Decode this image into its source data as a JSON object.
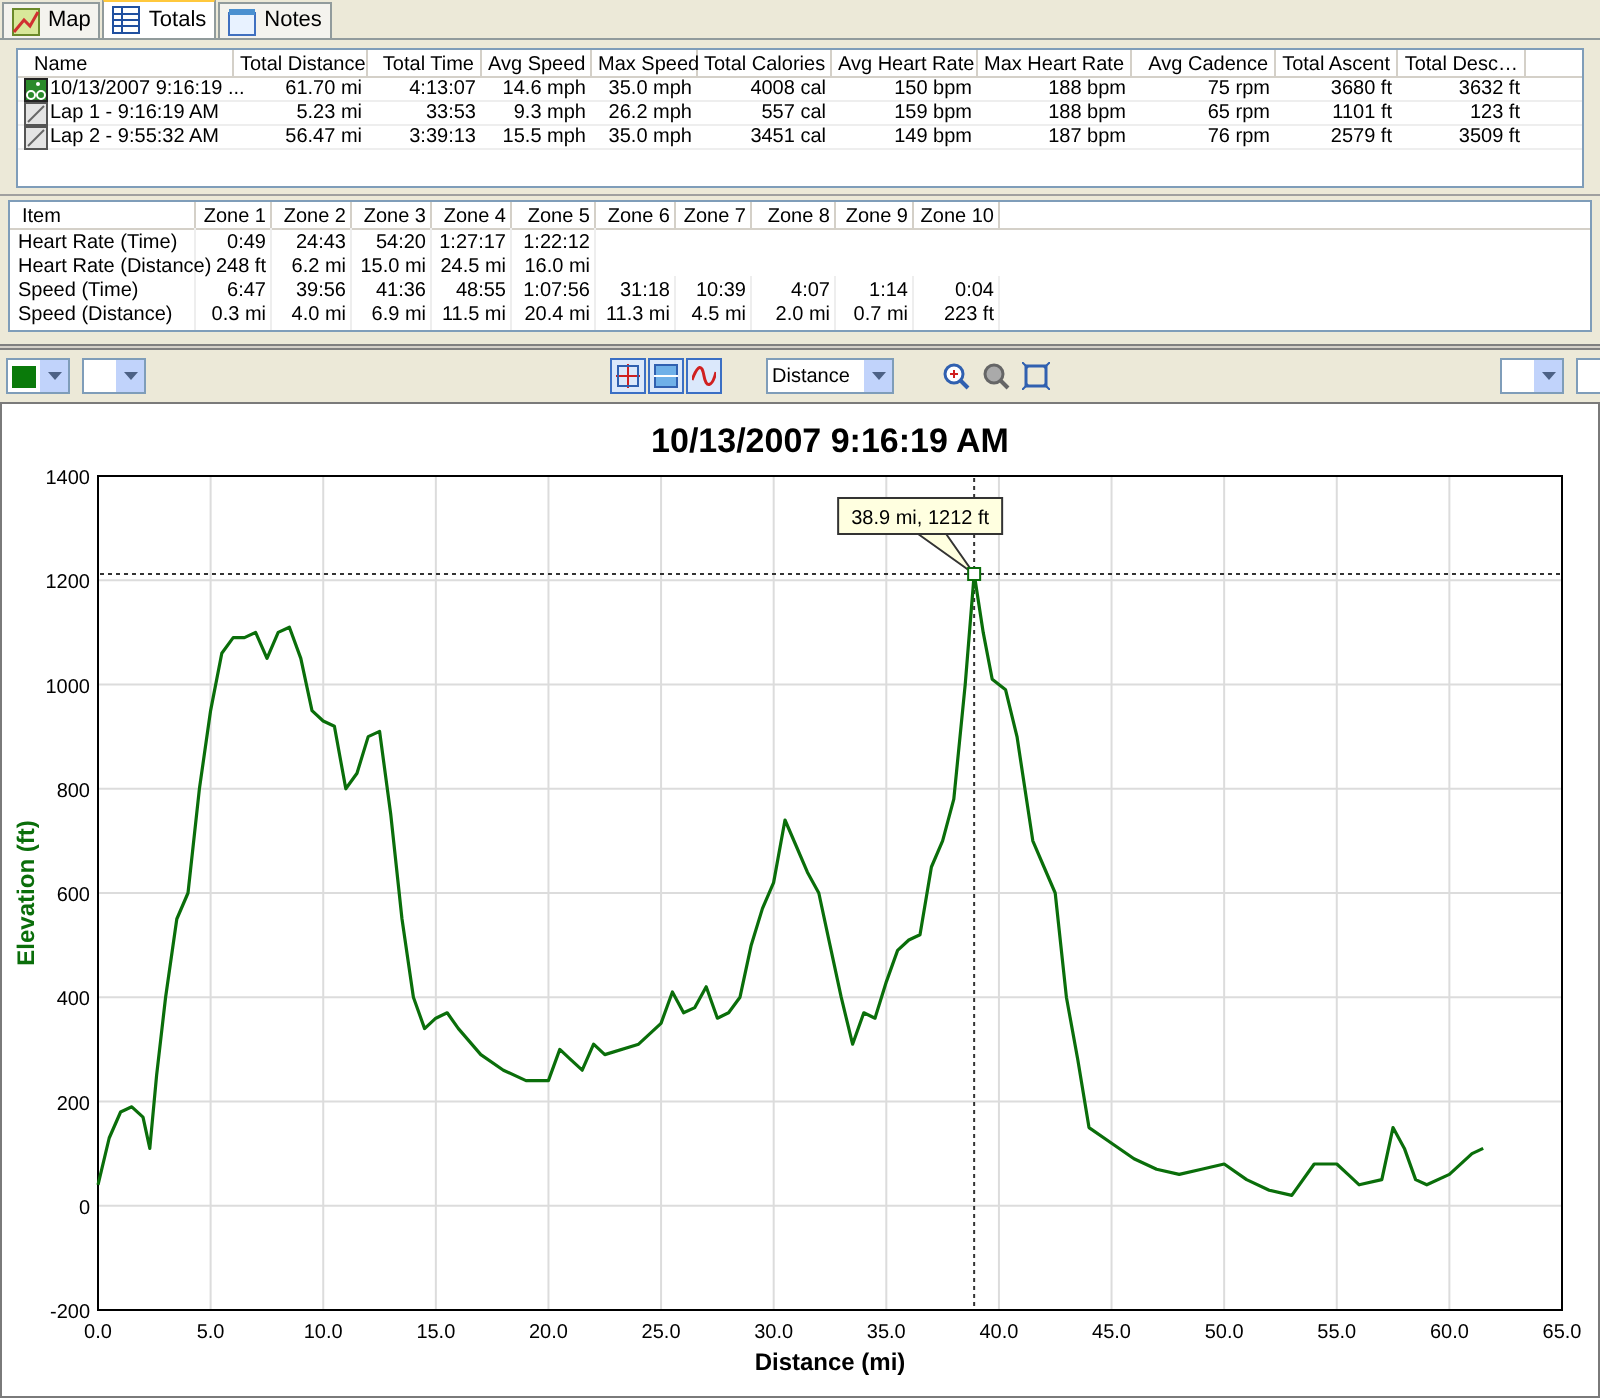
{
  "tabs": [
    {
      "label": "Map",
      "selected": false
    },
    {
      "label": "Totals",
      "selected": true
    },
    {
      "label": "Notes",
      "selected": false
    }
  ],
  "totals": {
    "columns": [
      "Name",
      "Total Distance",
      "Total Time",
      "Avg Speed",
      "Max Speed",
      "Total Calories",
      "Avg Heart Rate",
      "Max Heart Rate",
      "Avg Cadence",
      "Total Ascent",
      "Total Desc…"
    ],
    "rows": [
      {
        "kind": "activity",
        "cells": [
          "10/13/2007 9:16:19 ...",
          "61.70 mi",
          "4:13:07",
          "14.6 mph",
          "35.0 mph",
          "4008 cal",
          "150 bpm",
          "188 bpm",
          "75 rpm",
          "3680 ft",
          "3632 ft"
        ]
      },
      {
        "kind": "lap",
        "cells": [
          "Lap 1 - 9:16:19 AM",
          "5.23 mi",
          "33:53",
          "9.3 mph",
          "26.2 mph",
          "557 cal",
          "159 bpm",
          "188 bpm",
          "65 rpm",
          "1101 ft",
          "123 ft"
        ]
      },
      {
        "kind": "lap",
        "cells": [
          "Lap 2 - 9:55:32 AM",
          "56.47 mi",
          "3:39:13",
          "15.5 mph",
          "35.0 mph",
          "3451 cal",
          "149 bpm",
          "187 bpm",
          "76 rpm",
          "2579 ft",
          "3509 ft"
        ]
      }
    ]
  },
  "zones": {
    "columns": [
      "Item",
      "Zone 1",
      "Zone 2",
      "Zone 3",
      "Zone 4",
      "Zone 5",
      "Zone 6",
      "Zone 7",
      "Zone 8",
      "Zone 9",
      "Zone 10"
    ],
    "rows": [
      [
        "Heart Rate (Time)",
        "0:49",
        "24:43",
        "54:20",
        "1:27:17",
        "1:22:12"
      ],
      [
        "Heart Rate (Distance)",
        "248 ft",
        "6.2 mi",
        "15.0 mi",
        "24.5 mi",
        "16.0 mi"
      ],
      [
        "Speed (Time)",
        "6:47",
        "39:56",
        "41:36",
        "48:55",
        "1:07:56",
        "31:18",
        "10:39",
        "4:07",
        "1:14",
        "0:04"
      ],
      [
        "Speed (Distance)",
        "0.3 mi",
        "4.0 mi",
        "6.9 mi",
        "11.5 mi",
        "20.4 mi",
        "11.3 mi",
        "4.5 mi",
        "2.0 mi",
        "0.7 mi",
        "223 ft"
      ]
    ]
  },
  "toolbar": {
    "x_axis_select": "Distance"
  },
  "chart_data": {
    "type": "line",
    "title": "10/13/2007 9:16:19 AM",
    "xlabel": "Distance (mi)",
    "ylabel": "Elevation (ft)",
    "x": [
      0,
      0.5,
      1,
      1.5,
      2,
      2.3,
      2.6,
      3,
      3.5,
      4,
      4.5,
      5,
      5.5,
      6,
      6.5,
      7,
      7.5,
      8,
      8.5,
      9,
      9.5,
      10,
      10.5,
      11,
      11.5,
      12,
      12.5,
      13,
      13.5,
      14,
      14.5,
      15,
      15.5,
      16,
      17,
      18,
      19,
      20,
      20.5,
      21,
      21.5,
      22,
      22.5,
      24,
      25,
      25.5,
      26,
      26.5,
      27,
      27.5,
      28,
      28.5,
      29,
      29.5,
      30,
      30.5,
      31,
      31.5,
      32,
      32.5,
      33,
      33.5,
      34,
      34.5,
      35,
      35.5,
      36,
      36.5,
      37,
      37.5,
      38,
      38.5,
      38.9,
      39.3,
      39.7,
      40.3,
      40.8,
      41.5,
      42,
      42.5,
      43,
      43.5,
      44,
      45,
      46,
      47,
      48,
      49,
      50,
      51,
      52,
      53,
      54,
      55,
      55.5,
      56,
      57,
      57.5,
      58,
      58.5,
      59,
      60,
      61,
      61.5
    ],
    "grid": true,
    "series": [
      {
        "color": "#0a6e0a",
        "values": [
          40,
          130,
          180,
          190,
          170,
          110,
          250,
          400,
          550,
          600,
          800,
          950,
          1060,
          1090,
          1090,
          1100,
          1050,
          1100,
          1110,
          1050,
          950,
          930,
          920,
          800,
          830,
          900,
          910,
          750,
          550,
          400,
          340,
          360,
          370,
          340,
          290,
          260,
          240,
          240,
          300,
          280,
          260,
          310,
          290,
          310,
          350,
          410,
          370,
          380,
          420,
          360,
          370,
          400,
          500,
          570,
          620,
          740,
          690,
          640,
          600,
          500,
          400,
          310,
          370,
          360,
          430,
          490,
          510,
          520,
          650,
          700,
          780,
          1000,
          1212,
          1100,
          1010,
          990,
          900,
          700,
          650,
          600,
          400,
          280,
          150,
          120,
          90,
          70,
          60,
          70,
          80,
          50,
          30,
          20,
          80,
          80,
          60,
          40,
          50,
          150,
          110,
          50,
          40,
          60,
          100,
          110
        ]
      }
    ],
    "xlim": [
      0,
      65
    ],
    "ylim": [
      -200,
      1400
    ],
    "xticks": [
      {
        "value": 0,
        "label": "0.0"
      },
      {
        "value": 5,
        "label": "5.0"
      },
      {
        "value": 10,
        "label": "10.0"
      },
      {
        "value": 15,
        "label": "15.0"
      },
      {
        "value": 20,
        "label": "20.0"
      },
      {
        "value": 25,
        "label": "25.0"
      },
      {
        "value": 30,
        "label": "30.0"
      },
      {
        "value": 35,
        "label": "35.0"
      },
      {
        "value": 40,
        "label": "40.0"
      },
      {
        "value": 45,
        "label": "45.0"
      },
      {
        "value": 50,
        "label": "50.0"
      },
      {
        "value": 55,
        "label": "55.0"
      },
      {
        "value": 60,
        "label": "60.0"
      },
      {
        "value": 65,
        "label": "65.0"
      }
    ],
    "yticks": [
      -200,
      0,
      200,
      400,
      600,
      800,
      1000,
      1200,
      1400
    ],
    "ref_lines": [
      {
        "axis": "x",
        "value": 38.9
      },
      {
        "axis": "y",
        "value": 1212
      }
    ],
    "annotations": [
      {
        "x": 38.9,
        "y": 1212,
        "text": "38.9 mi, 1212 ft"
      }
    ]
  }
}
